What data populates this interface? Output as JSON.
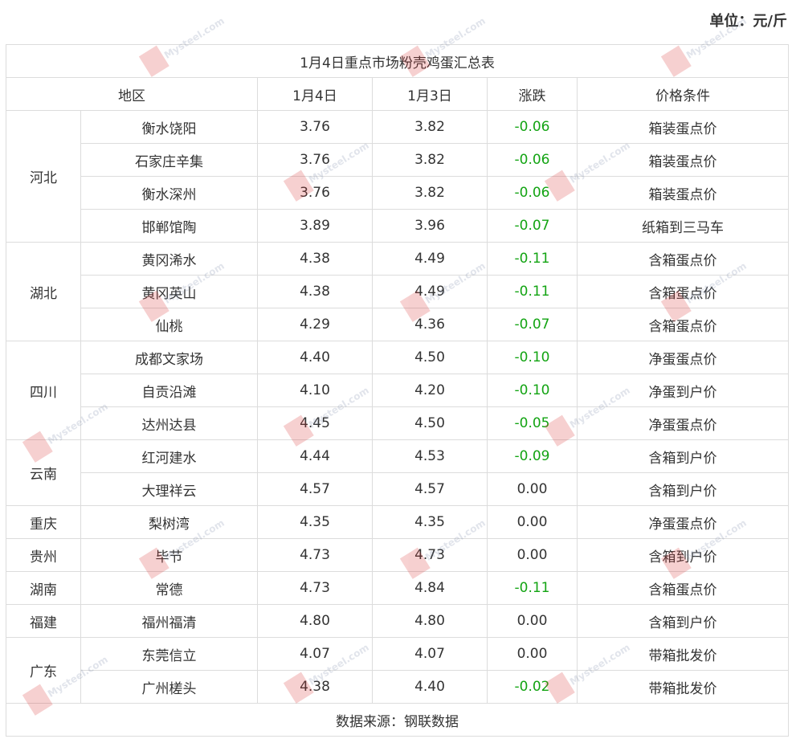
{
  "unit_label": "单位：元/斤",
  "table": {
    "title": "1月4日重点市场粉壳鸡蛋汇总表",
    "headers": [
      "地区",
      "1月4日",
      "1月3日",
      "涨跌",
      "价格条件"
    ],
    "groups": [
      {
        "region": "河北",
        "rows": [
          {
            "market": "衡水饶阳",
            "jan4": "3.76",
            "jan3": "3.82",
            "change": "-0.06",
            "condition": "箱装蛋点价"
          },
          {
            "market": "石家庄辛集",
            "jan4": "3.76",
            "jan3": "3.82",
            "change": "-0.06",
            "condition": "箱装蛋点价"
          },
          {
            "market": "衡水深州",
            "jan4": "3.76",
            "jan3": "3.82",
            "change": "-0.06",
            "condition": "箱装蛋点价"
          },
          {
            "market": "邯郸馆陶",
            "jan4": "3.89",
            "jan3": "3.96",
            "change": "-0.07",
            "condition": "纸箱到三马车"
          }
        ]
      },
      {
        "region": "湖北",
        "rows": [
          {
            "market": "黄冈浠水",
            "jan4": "4.38",
            "jan3": "4.49",
            "change": "-0.11",
            "condition": "含箱蛋点价"
          },
          {
            "market": "黄冈英山",
            "jan4": "4.38",
            "jan3": "4.49",
            "change": "-0.11",
            "condition": "含箱蛋点价"
          },
          {
            "market": "仙桃",
            "jan4": "4.29",
            "jan3": "4.36",
            "change": "-0.07",
            "condition": "含箱蛋点价"
          }
        ]
      },
      {
        "region": "四川",
        "rows": [
          {
            "market": "成都文家场",
            "jan4": "4.40",
            "jan3": "4.50",
            "change": "-0.10",
            "condition": "净蛋蛋点价"
          },
          {
            "market": "自贡沿滩",
            "jan4": "4.10",
            "jan3": "4.20",
            "change": "-0.10",
            "condition": "净蛋到户价"
          },
          {
            "market": "达州达县",
            "jan4": "4.45",
            "jan3": "4.50",
            "change": "-0.05",
            "condition": "净蛋蛋点价"
          }
        ]
      },
      {
        "region": "云南",
        "rows": [
          {
            "market": "红河建水",
            "jan4": "4.44",
            "jan3": "4.53",
            "change": "-0.09",
            "condition": "含箱到户价"
          },
          {
            "market": "大理祥云",
            "jan4": "4.57",
            "jan3": "4.57",
            "change": "0.00",
            "condition": "含箱到户价"
          }
        ]
      },
      {
        "region": "重庆",
        "rows": [
          {
            "market": "梨树湾",
            "jan4": "4.35",
            "jan3": "4.35",
            "change": "0.00",
            "condition": "净蛋蛋点价"
          }
        ]
      },
      {
        "region": "贵州",
        "rows": [
          {
            "market": "毕节",
            "jan4": "4.73",
            "jan3": "4.73",
            "change": "0.00",
            "condition": "含箱到户价"
          }
        ]
      },
      {
        "region": "湖南",
        "rows": [
          {
            "market": "常德",
            "jan4": "4.73",
            "jan3": "4.84",
            "change": "-0.11",
            "condition": "含箱蛋点价"
          }
        ]
      },
      {
        "region": "福建",
        "rows": [
          {
            "market": "福州福清",
            "jan4": "4.80",
            "jan3": "4.80",
            "change": "0.00",
            "condition": "含箱到户价"
          }
        ]
      },
      {
        "region": "广东",
        "rows": [
          {
            "market": "东莞信立",
            "jan4": "4.07",
            "jan3": "4.07",
            "change": "0.00",
            "condition": "带箱批发价"
          },
          {
            "market": "广州槎头",
            "jan4": "4.38",
            "jan3": "4.40",
            "change": "-0.02",
            "condition": "带箱批发价"
          }
        ]
      }
    ],
    "footer": "数据来源：钢联数据"
  },
  "watermark": {
    "text": "Mysteel.com"
  },
  "colors": {
    "negative_change": "#13a413",
    "border": "#dcdcdc",
    "text": "#333333"
  }
}
